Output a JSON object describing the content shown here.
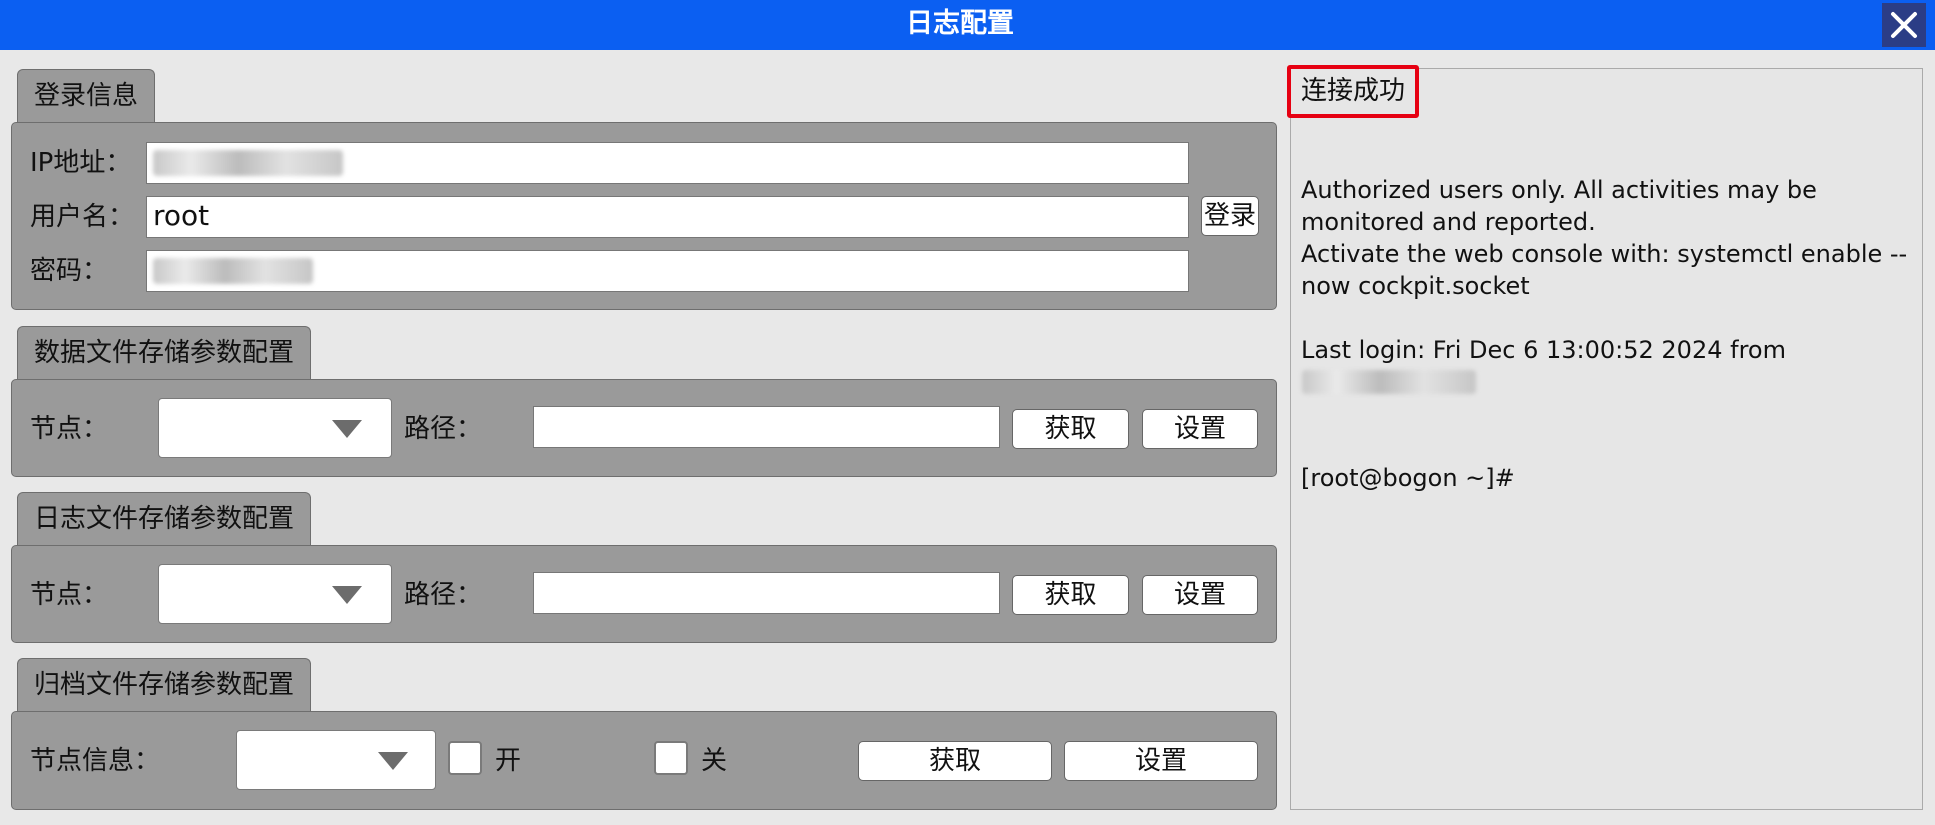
{
  "window": {
    "title": "日志配置",
    "close_icon": "close-icon"
  },
  "login": {
    "tab_label": "登录信息",
    "ip_label": "IP地址：",
    "user_label": "用户名：",
    "user_value": "root",
    "password_label": "密码：",
    "login_button": "登录"
  },
  "data_storage": {
    "tab_label": "数据文件存储参数配置",
    "node_label": "节点：",
    "path_label": "路径：",
    "get_button": "获取",
    "set_button": "设置"
  },
  "log_storage": {
    "tab_label": "日志文件存储参数配置",
    "node_label": "节点：",
    "path_label": "路径：",
    "get_button": "获取",
    "set_button": "设置"
  },
  "archive_storage": {
    "tab_label": "归档文件存储参数配置",
    "node_info_label": "节点信息：",
    "on_label": "开",
    "off_label": "关",
    "get_button": "获取",
    "set_button": "设置"
  },
  "console": {
    "status": "连接成功",
    "lines": [
      "Authorized users only. All activities may be",
      "monitored and reported.",
      "Activate the web console with: systemctl enable --",
      "now cockpit.socket",
      "Last login: Fri Dec  6 13:00:52 2024 from",
      "[root@bogon ~]#"
    ]
  },
  "colors": {
    "titlebar": "#0b5ff2",
    "panel": "#9a9a9a",
    "status_border": "#e60012"
  }
}
